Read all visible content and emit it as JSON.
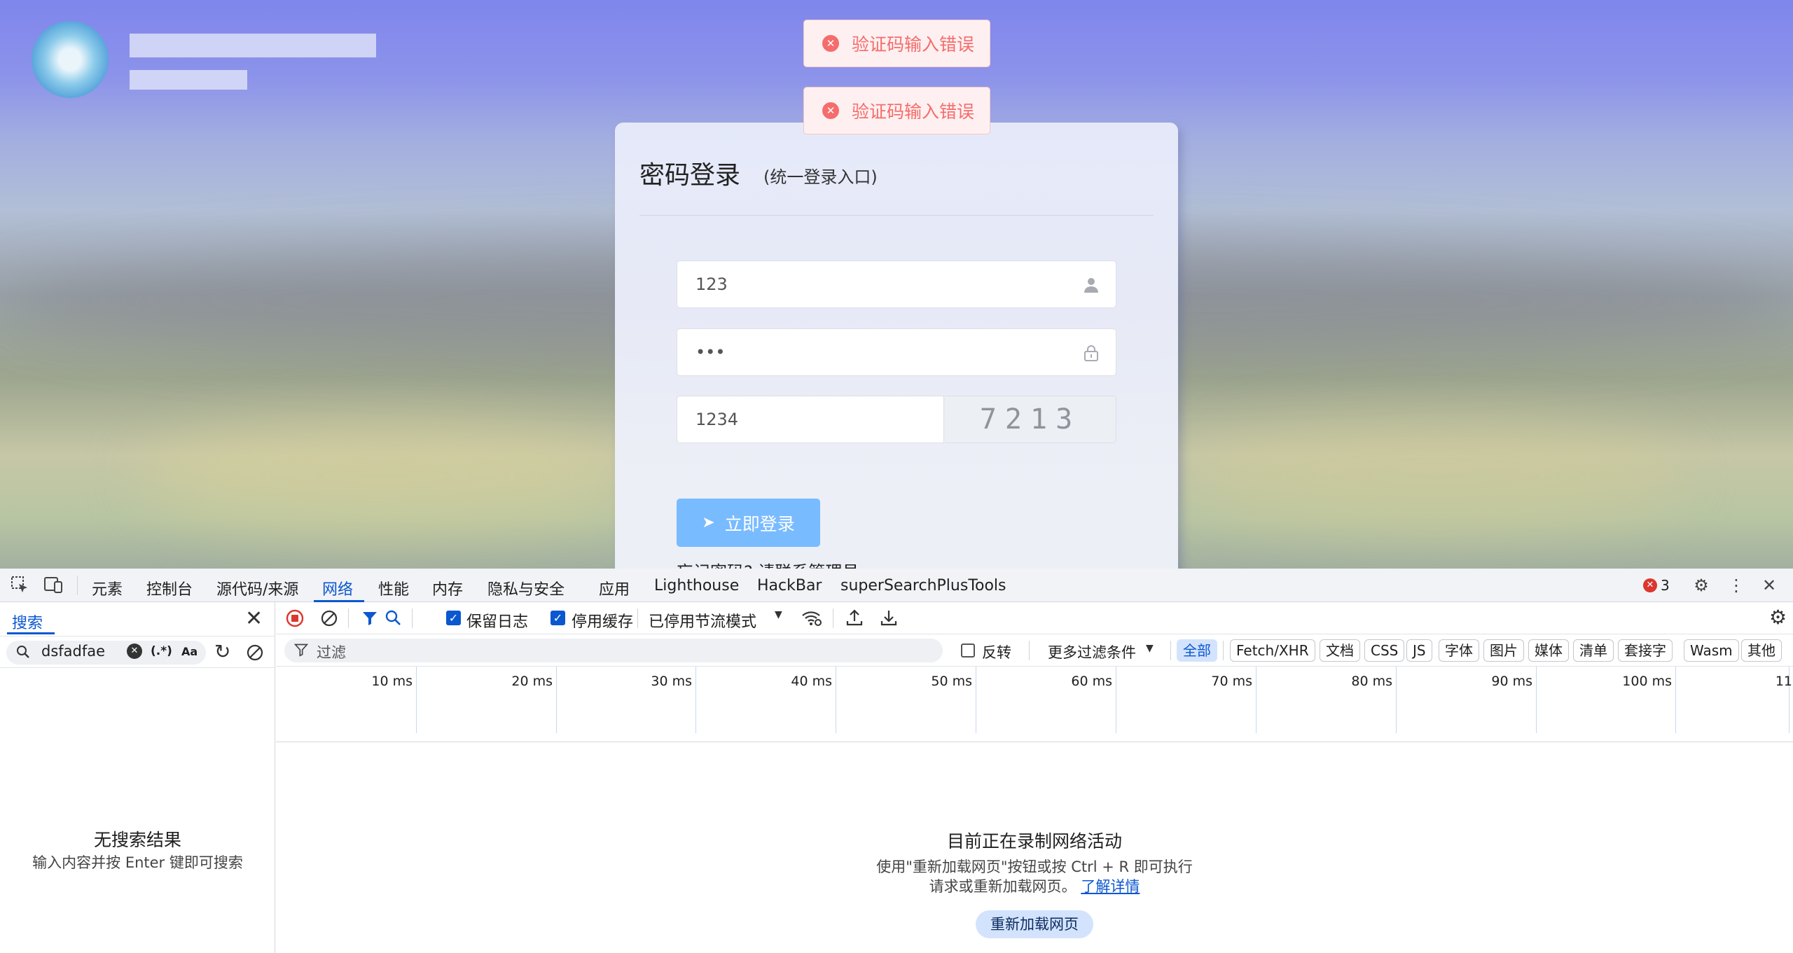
{
  "page": {
    "toasts": [
      {
        "message": "验证码输入错误"
      },
      {
        "message": "验证码输入错误"
      }
    ],
    "login": {
      "title": "密码登录",
      "subtitle": "(统一登录入口)",
      "username_value": "123",
      "password_value": "•••",
      "captcha_value": "1234",
      "captcha_image_text": "7213",
      "submit_label": "立即登录",
      "forgot_text": "忘记密码? 请联系管理员"
    }
  },
  "devtools": {
    "tabs": [
      "元素",
      "控制台",
      "源代码/来源",
      "网络",
      "性能",
      "内存",
      "隐私与安全",
      "应用",
      "Lighthouse",
      "HackBar",
      "superSearchPlusTools"
    ],
    "active_tab": "网络",
    "error_count": "3",
    "search_panel": {
      "tab_label": "搜索",
      "query": "dsfadfae",
      "regex_toggle": "(.*)",
      "case_toggle": "Aa",
      "no_results_title": "无搜索结果",
      "no_results_hint": "输入内容并按 Enter 键即可搜索"
    },
    "toolbar": {
      "preserve_log_label": "保留日志",
      "preserve_log_checked": true,
      "disable_cache_label": "停用缓存",
      "disable_cache_checked": true,
      "throttling_value": "已停用节流模式"
    },
    "filter_bar": {
      "filter_placeholder": "过滤",
      "invert_label": "反转",
      "invert_checked": false,
      "more_filters_label": "更多过滤条件",
      "types": [
        "全部",
        "Fetch/XHR",
        "文档",
        "CSS",
        "JS",
        "字体",
        "图片",
        "媒体",
        "清单",
        "套接字",
        "Wasm",
        "其他"
      ],
      "selected_type": "全部"
    },
    "timeline": {
      "ticks": [
        "10 ms",
        "20 ms",
        "30 ms",
        "40 ms",
        "50 ms",
        "60 ms",
        "70 ms",
        "80 ms",
        "90 ms",
        "100 ms",
        "11"
      ]
    },
    "empty_state": {
      "title": "目前正在录制网络活动",
      "desc_line1": "使用\"重新加载网页\"按钮或按 Ctrl + R 即可执行",
      "desc_line2_prefix": "请求或重新加载网页。",
      "learn_more": "了解详情",
      "reload_button": "重新加载网页"
    },
    "colors": {
      "accent": "#0b57d0",
      "error_toast": "#f56c6c",
      "login_button": "#79bbff"
    }
  }
}
